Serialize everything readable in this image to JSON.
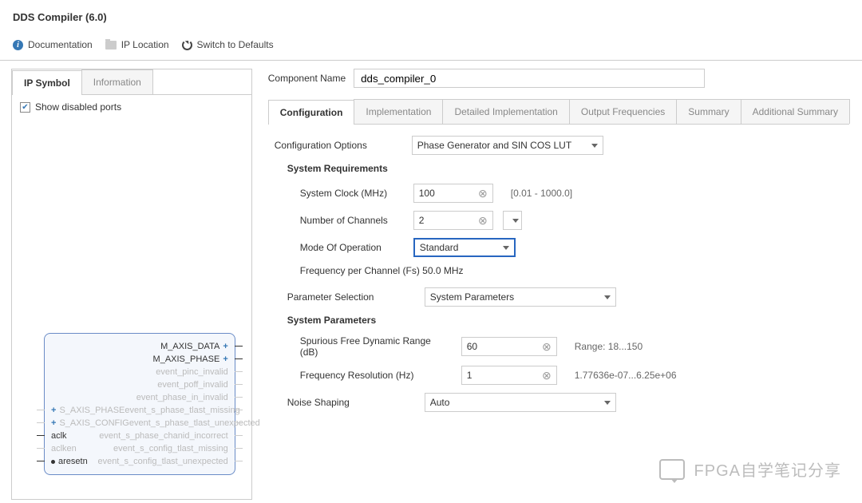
{
  "header": {
    "title": "DDS Compiler (6.0)"
  },
  "toolbar": {
    "doc": "Documentation",
    "ip_location": "IP Location",
    "switch_defaults": "Switch to Defaults"
  },
  "left": {
    "tabs": {
      "symbol": "IP Symbol",
      "info": "Information"
    },
    "show_disabled": "Show disabled ports",
    "ports_left": [
      {
        "name": "S_AXIS_PHASE",
        "bus": true,
        "disabled": true
      },
      {
        "name": "S_AXIS_CONFIG",
        "bus": true,
        "disabled": true
      },
      {
        "name": "aclk",
        "bus": false,
        "disabled": false
      },
      {
        "name": "aclken",
        "bus": false,
        "disabled": true
      },
      {
        "name": "aresetn",
        "bus": false,
        "disabled": false,
        "dot": true
      }
    ],
    "ports_right": [
      {
        "name": "M_AXIS_DATA",
        "bus": true,
        "disabled": false
      },
      {
        "name": "M_AXIS_PHASE",
        "bus": true,
        "disabled": false
      },
      {
        "name": "event_pinc_invalid",
        "bus": false,
        "disabled": true
      },
      {
        "name": "event_poff_invalid",
        "bus": false,
        "disabled": true
      },
      {
        "name": "event_phase_in_invalid",
        "bus": false,
        "disabled": true
      },
      {
        "name": "event_s_phase_tlast_missing",
        "bus": false,
        "disabled": true
      },
      {
        "name": "event_s_phase_tlast_unexpected",
        "bus": false,
        "disabled": true
      },
      {
        "name": "event_s_phase_chanid_incorrect",
        "bus": false,
        "disabled": true
      },
      {
        "name": "event_s_config_tlast_missing",
        "bus": false,
        "disabled": true
      },
      {
        "name": "event_s_config_tlast_unexpected",
        "bus": false,
        "disabled": true
      }
    ]
  },
  "right": {
    "component_name_label": "Component Name",
    "component_name": "dds_compiler_0",
    "tabs": [
      "Configuration",
      "Implementation",
      "Detailed Implementation",
      "Output Frequencies",
      "Summary",
      "Additional Summary"
    ],
    "config_options_label": "Configuration Options",
    "config_options_value": "Phase Generator and SIN COS LUT",
    "sys_req_title": "System Requirements",
    "sys_clock_label": "System Clock (MHz)",
    "sys_clock_value": "100",
    "sys_clock_hint": "[0.01 - 1000.0]",
    "num_channels_label": "Number of Channels",
    "num_channels_value": "2",
    "mode_op_label": "Mode Of Operation",
    "mode_op_value": "Standard",
    "freq_per_ch": "Frequency per Channel (Fs) 50.0 MHz",
    "param_sel_label": "Parameter Selection",
    "param_sel_value": "System Parameters",
    "sys_params_title": "System Parameters",
    "sfdr_label": "Spurious Free Dynamic Range (dB)",
    "sfdr_value": "60",
    "sfdr_hint": "Range: 18...150",
    "freq_res_label": "Frequency Resolution (Hz)",
    "freq_res_value": "1",
    "freq_res_hint": "1.77636e-07...6.25e+06",
    "noise_shaping_label": "Noise Shaping",
    "noise_shaping_value": "Auto"
  },
  "watermark": "FPGA自学笔记分享"
}
